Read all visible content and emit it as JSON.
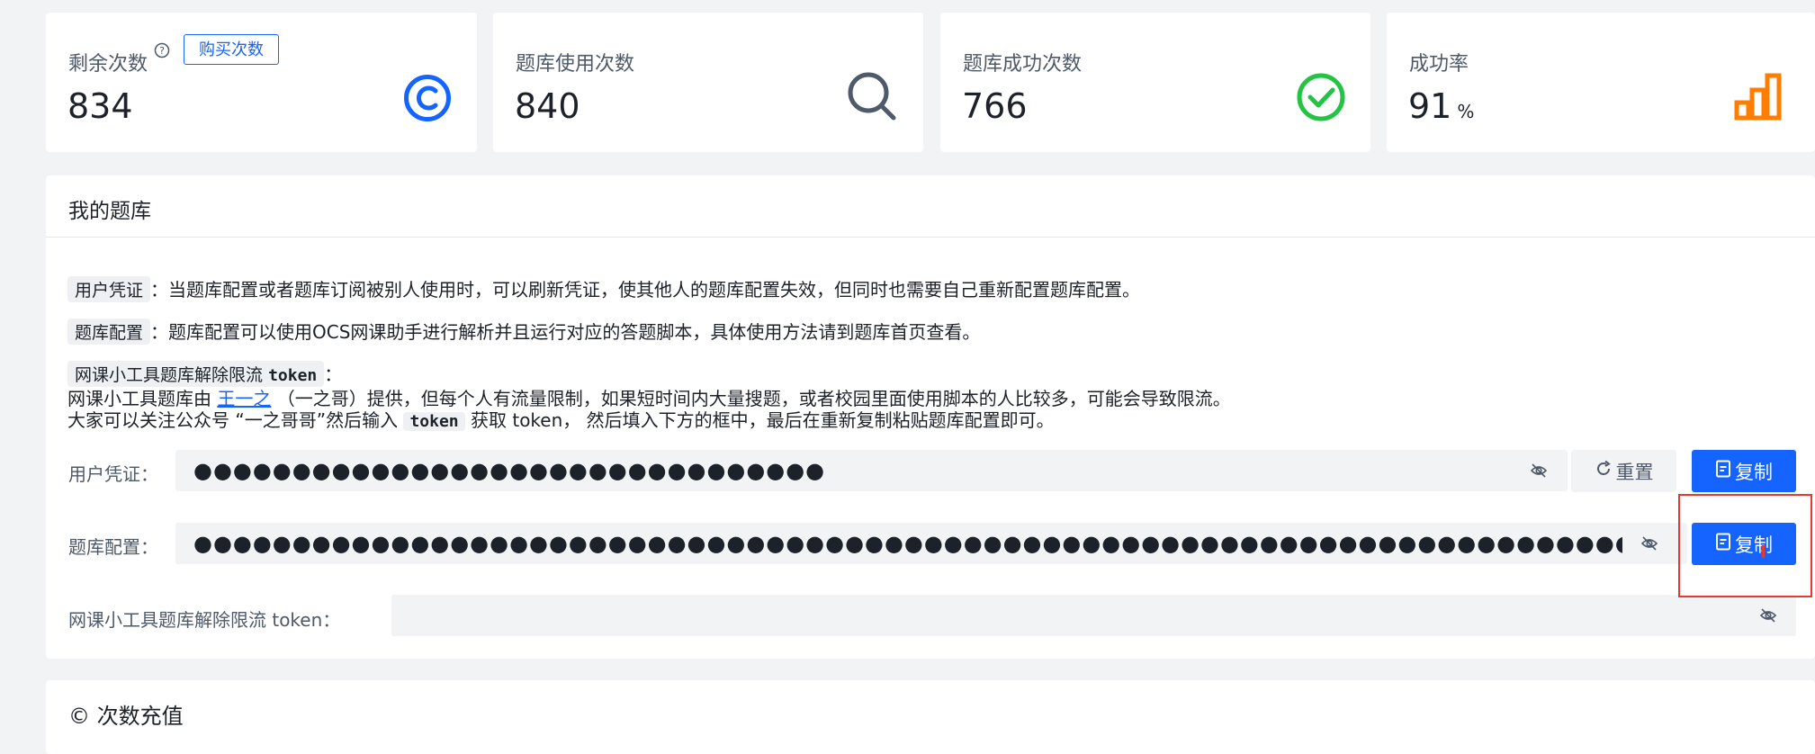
{
  "stats": {
    "remaining": {
      "label": "剩余次数",
      "value": "834",
      "buy_label": "购买次数",
      "icon": "copyright-icon",
      "color": "#1664ff"
    },
    "usage": {
      "label": "题库使用次数",
      "value": "840",
      "icon": "search-icon",
      "color": "#4e5969"
    },
    "success": {
      "label": "题库成功次数",
      "value": "766",
      "icon": "check-circle-icon",
      "color": "#23c343"
    },
    "rate": {
      "label": "成功率",
      "value": "91",
      "unit": "%",
      "icon": "bar-chart-icon",
      "color": "#ff7d00"
    }
  },
  "library": {
    "title": "我的题库",
    "desc": {
      "token_tag": "用户凭证",
      "token_text": "：当题库配置或者题库订阅被别人使用时，可以刷新凭证，使其他人的题库配置失效，但同时也需要自己重新配置题库配置。",
      "config_tag": "题库配置",
      "config_text": "：题库配置可以使用OCS网课助手进行解析并且运行对应的答题脚本，具体使用方法请到题库首页查看。",
      "tool_tag": "网课小工具题库解除限流",
      "tool_tag_code": "token",
      "tool_colon": "：",
      "tool_line1_a": "网课小工具题库由",
      "tool_link": "王一之",
      "tool_line1_b": "（一之哥）提供，但每个人有流量限制，如果短时间内大量搜题，或者校园里面使用脚本的人比较多，可能会导致限流。",
      "tool_line2_a": "大家可以关注公众号 “一之哥哥”然后输入",
      "tool_line2_code": "token",
      "tool_line2_b": "获取 token， 然后填入下方的框中，最后在重新复制粘贴题库配置即可。"
    },
    "fields": {
      "token_label": "用户凭证：",
      "token_mask": "●●●●●●●●●●●●●●●●●●●●●●●●●●●●●●●●",
      "reset_label": "重置",
      "copy_label": "复制",
      "config_label": "题库配置：",
      "config_mask": "●●●●●●●●●●●●●●●●●●●●●●●●●●●●●●●●●●●●●●●●●●●●●●●●●●●●●●●●●●●●●●●●●●●●●●●●●●●●",
      "limit_label": "网课小工具题库解除限流 token：",
      "limit_value": ""
    }
  },
  "recharge": {
    "title": "© 次数充值"
  }
}
